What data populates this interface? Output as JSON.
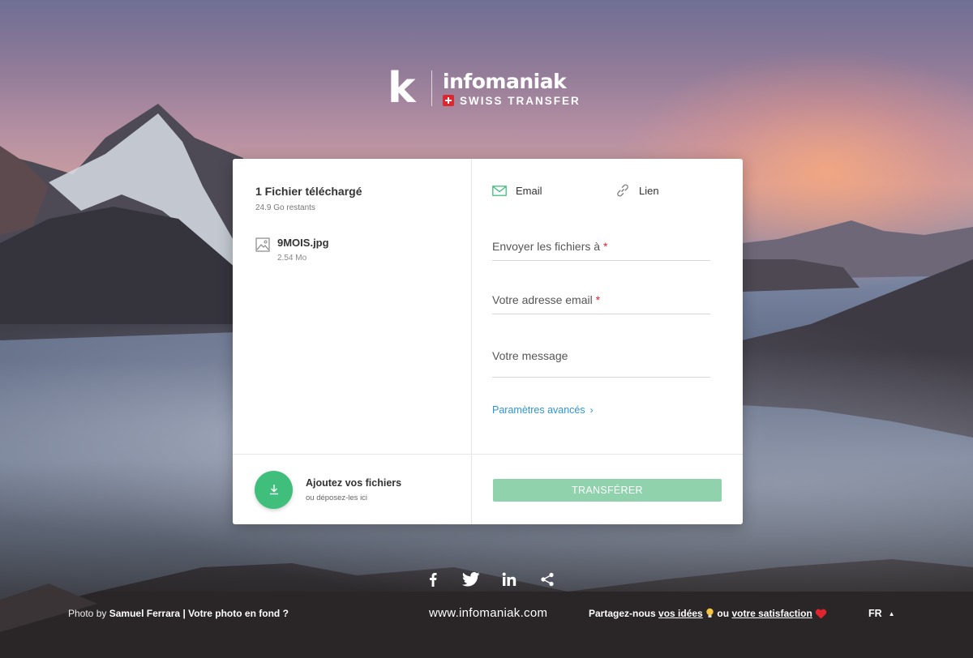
{
  "brand": {
    "logo_letter": "k",
    "name": "infomaniak",
    "product": "SWISS TRANSFER"
  },
  "files_panel": {
    "title": "1 Fichier téléchargé",
    "remaining": "24.9 Go restants",
    "files": [
      {
        "name": "9MOIS.jpg",
        "size": "2.54 Mo",
        "icon": "image-icon"
      }
    ],
    "add": {
      "title": "Ajoutez vos fichiers",
      "subtitle": "ou déposez-les ici",
      "icon": "download-icon"
    }
  },
  "form": {
    "tabs": [
      {
        "label": "Email",
        "icon": "envelope-icon"
      },
      {
        "label": "Lien",
        "icon": "link-icon"
      }
    ],
    "fields": {
      "recipients": {
        "label": "Envoyer les fichiers à",
        "required_mark": "*"
      },
      "sender": {
        "label": "Votre adresse email",
        "required_mark": "*"
      },
      "message": {
        "label": "Votre message"
      }
    },
    "advanced": "Paramètres avancés",
    "advanced_chevron": "›",
    "submit": "TRANSFÉRER"
  },
  "footer": {
    "social": [
      "facebook-icon",
      "twitter-icon",
      "linkedin-icon",
      "share-icon"
    ],
    "credit_prefix": "Photo by",
    "credit_author": "Samuel Ferrara",
    "credit_sep": "|",
    "credit_link": "Votre photo en fond ?",
    "site": "www.infomaniak.com",
    "share_prefix": "Partagez-nous",
    "share_ideas": "vos idées",
    "share_mid": "ou",
    "share_satisfaction": "votre satisfaction",
    "language": "FR",
    "language_caret": "▲"
  },
  "colors": {
    "accent_green": "#3fbe7c",
    "button_disabled": "#8fd2ac",
    "link_blue": "#2c95d6",
    "required_red": "#e0262d"
  }
}
